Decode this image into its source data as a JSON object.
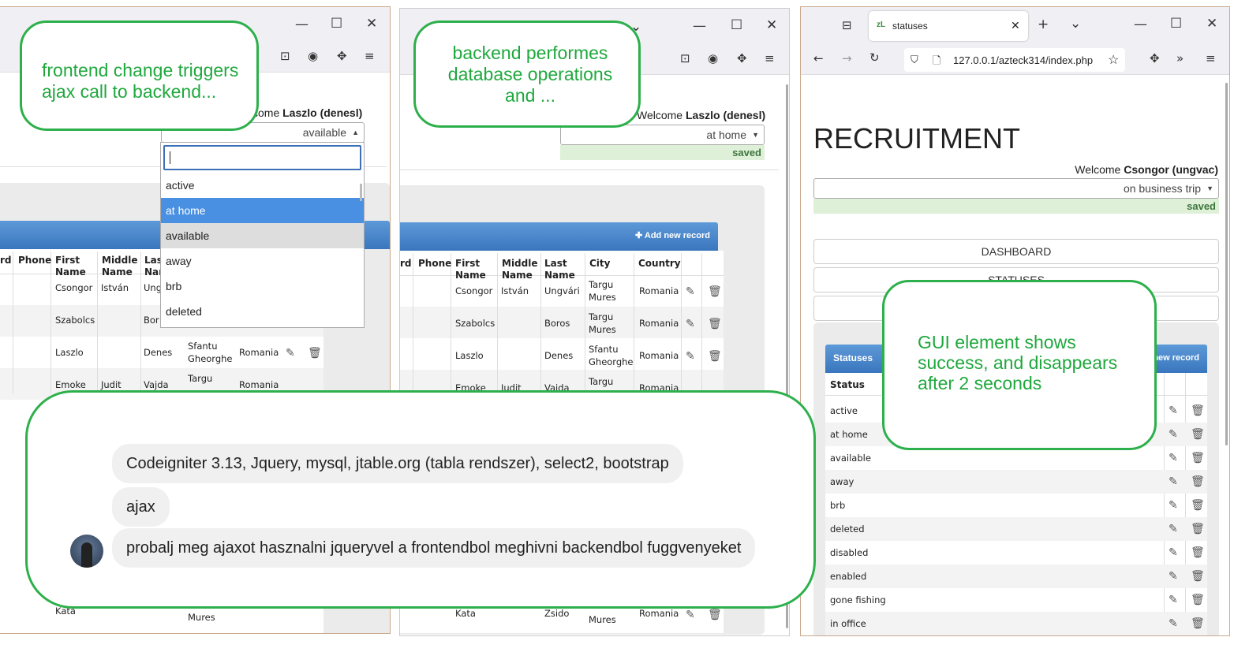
{
  "left_window": {
    "welcome_prefix": "come ",
    "welcome_user": "Laszlo (denesl)",
    "select_value": "available",
    "dropdown_options": [
      "active",
      "at home",
      "available",
      "away",
      "brb",
      "deleted"
    ],
    "columns": [
      "rd",
      "Phone",
      "First Name",
      "Middle Name",
      "Las Nar"
    ],
    "rows": [
      {
        "first": "Csongor",
        "middle": "István",
        "last": "Ung"
      },
      {
        "first": "Szabolcs",
        "middle": "",
        "last": "Bor"
      },
      {
        "first": "Laszlo",
        "middle": "",
        "last": "Denes",
        "city": "Sfantu Gheorghe",
        "country": "Romania"
      },
      {
        "first": "Emoke",
        "middle": "Judit",
        "last": "Vajda",
        "city": "Targu",
        "country": "Romania"
      },
      {
        "first": "Kata",
        "middle": "",
        "last": "",
        "city": "Mures",
        "country": ""
      }
    ]
  },
  "middle_window": {
    "welcome_prefix": "Welcome ",
    "welcome_user": "Laszlo (denesl)",
    "select_value": "at home",
    "saved_label": "saved",
    "add_record": "Add new record",
    "columns": [
      "rd",
      "Phone",
      "First Name",
      "Middle Name",
      "Last Name",
      "City",
      "Country"
    ],
    "rows": [
      {
        "first": "Csongor",
        "middle": "István",
        "last": "Ungvári",
        "city": "Targu Mures",
        "country": "Romania"
      },
      {
        "first": "Szabolcs",
        "middle": "",
        "last": "Boros",
        "city": "Targu Mures",
        "country": "Romania"
      },
      {
        "first": "Laszlo",
        "middle": "",
        "last": "Denes",
        "city": "Sfantu Gheorghe",
        "country": "Romania"
      },
      {
        "first": "Emoke",
        "middle": "Judit",
        "last": "Vajda",
        "city": "Targu",
        "country": "Romania"
      },
      {
        "first": "Kata",
        "middle": "",
        "last": "Zsido",
        "city": "Mures",
        "country": "Romania"
      }
    ]
  },
  "right_window": {
    "tab_favicon": "zL",
    "tab_title": "statuses",
    "url": "127.0.0.1/azteck314/index.php",
    "page_title": "RECRUITMENT",
    "welcome_prefix": "Welcome ",
    "welcome_user": "Csongor (ungvac)",
    "select_value": "on business trip",
    "saved_label": "saved",
    "nav": [
      "DASHBOARD",
      "STATUSES"
    ],
    "table_title": "Statuses",
    "add_record": "new record",
    "column": "Status",
    "statuses": [
      "active",
      "at home",
      "available",
      "away",
      "brb",
      "deleted",
      "disabled",
      "enabled",
      "gone fishing",
      "in office"
    ]
  },
  "callouts": {
    "c1": "frontend change triggers ajax call to backend...",
    "c2": "backend performes database operations and ...",
    "c3": "GUI element shows success, and disappears after 2 seconds"
  },
  "chat": {
    "messages": [
      "Codeigniter 3.13, Jquery, mysql, jtable.org (tabla rendszer), select2, bootstrap",
      "ajax",
      "probalj meg ajaxot hasznalni jqueryvel a frontendbol meghivni backendbol fuggvenyeket"
    ]
  },
  "colors": {
    "callout_border": "#2db04b",
    "callout_text": "#1fa83d",
    "accent_blue": "#3a76bd",
    "saved_bg": "#dff0d8"
  }
}
